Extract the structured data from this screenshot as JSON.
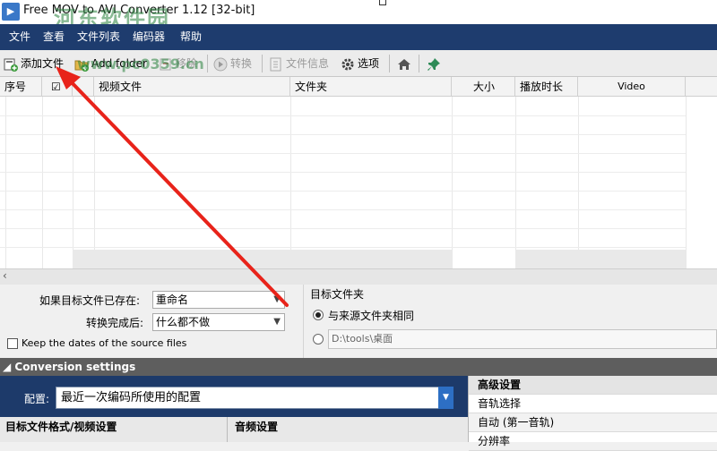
{
  "window": {
    "title": "Free MOV to AVI Converter 1.12  [32-bit]",
    "watermark_main": "河东软件园",
    "watermark_url": "www.pc0359.cn"
  },
  "menu": [
    "文件",
    "查看",
    "文件列表",
    "编码器",
    "帮助"
  ],
  "toolbar": {
    "add_file": "添加文件",
    "add_folder": "Add folder",
    "remove": "移除",
    "convert": "转换",
    "file_info": "文件信息",
    "options": "选项"
  },
  "table": {
    "columns": [
      "序号",
      "☑",
      "视频文件",
      "文件夹",
      "大小",
      "播放时长",
      "Video"
    ],
    "rows": []
  },
  "options": {
    "exists_label": "如果目标文件已存在:",
    "exists_value": "重命名",
    "after_label": "转换完成后:",
    "after_value": "什么都不做",
    "keep_dates_label": "Keep the dates of the source files",
    "keep_dates_checked": false,
    "target_folder_label": "目标文件夹",
    "same_as_source_label": "与来源文件夹相同",
    "same_as_source_selected": true,
    "custom_path": "D:\\tools\\桌面"
  },
  "conversion": {
    "header": "Conversion settings",
    "profile_label": "配置:",
    "profile_value": "最近一次编码所使用的配置",
    "video_section": "目标文件格式/视频设置",
    "audio_section": "音频设置"
  },
  "advanced": {
    "title": "高级设置",
    "track_label": "音轨选择",
    "track_value": "自动 (第一音轨)",
    "next_label": "分辨率"
  },
  "colors": {
    "menubar": "#1e3c6e",
    "annotation_arrow": "#e8231a",
    "dropdown_accent": "#2d6fc4"
  }
}
